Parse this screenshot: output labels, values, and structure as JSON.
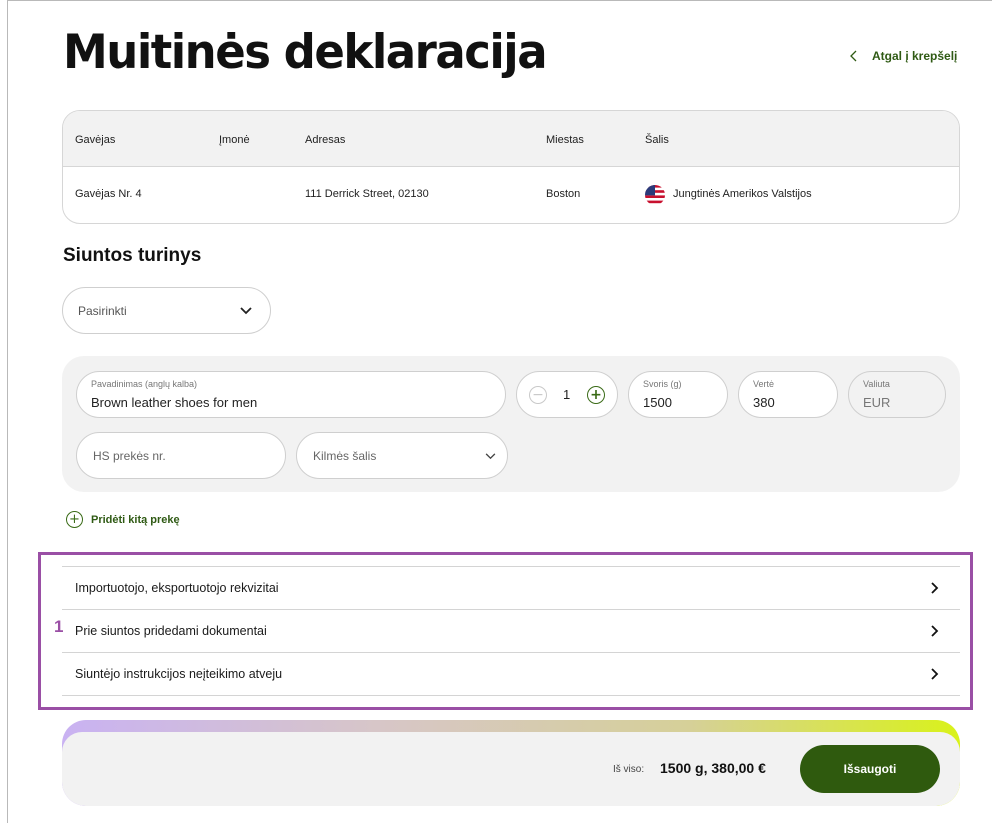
{
  "page": {
    "title": "Muitinės deklaracija"
  },
  "back_link": {
    "label": "Atgal į krepšelį"
  },
  "recipient_table": {
    "headers": [
      "Gavėjas",
      "Įmonė",
      "Adresas",
      "Miestas",
      "Šalis"
    ],
    "row": {
      "recipient": "Gavėjas Nr. 4",
      "company": "",
      "address": "111 Derrick Street, 02130",
      "city": "Boston",
      "country": "Jungtinės Amerikos Valstijos",
      "country_flag_icon": "us-flag-icon"
    }
  },
  "contents": {
    "title": "Siuntos turinys",
    "select_placeholder": "Pasirinkti"
  },
  "item": {
    "name_label": "Pavadinimas (anglų kalba)",
    "name_value": "Brown leather shoes for men",
    "quantity": "1",
    "weight_label": "Svoris (g)",
    "weight_value": "1500",
    "value_label": "Vertė",
    "value_value": "380",
    "currency_label": "Valiuta",
    "currency_value": "EUR",
    "hs_placeholder": "HS prekės nr.",
    "origin_placeholder": "Kilmės šalis"
  },
  "add_item": {
    "label": "Pridėti kitą prekę"
  },
  "annotation": {
    "number": "1",
    "color": "#9a4fa5"
  },
  "accordion": [
    {
      "label": "Importuotojo, eksportuotojo rekvizitai"
    },
    {
      "label": "Prie siuntos pridedami dokumentai"
    },
    {
      "label": "Siuntėjo instrukcijos neįteikimo atveju"
    }
  ],
  "footer": {
    "total_label": "Iš viso:",
    "total_value": "1500 g,  380,00 €",
    "save_label": "Išsaugoti"
  },
  "colors": {
    "accent_green": "#2f5a0e",
    "gradient": [
      "#c9b2f2",
      "#d9f21a"
    ]
  }
}
